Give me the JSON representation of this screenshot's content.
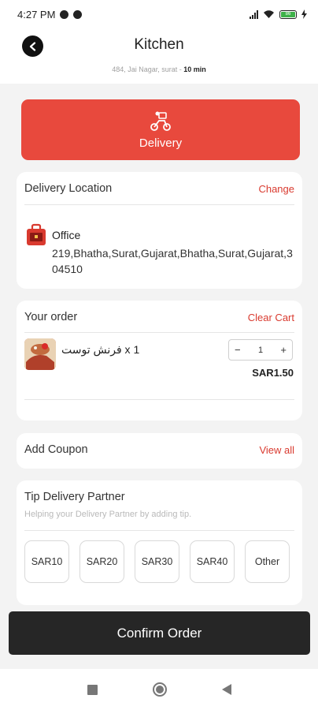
{
  "status_bar": {
    "time": "4:27 PM",
    "battery_level": "86"
  },
  "header": {
    "title": "Kitchen",
    "address": "484, Jai Nagar, surat",
    "separator": " - ",
    "eta": "10 min"
  },
  "delivery_mode": {
    "label": "Delivery",
    "color": "#e8493d"
  },
  "location": {
    "title": "Delivery Location",
    "change_label": "Change",
    "address_label": "Office",
    "address": "219,Bhatha,Surat,Gujarat,Bhatha,Surat,Gujarat,304510"
  },
  "order": {
    "title": "Your order",
    "clear_label": "Clear Cart",
    "items": [
      {
        "name": "فرنش توست x 1",
        "quantity": "1",
        "price": "SAR1.50",
        "minus": "−",
        "plus": "+"
      }
    ]
  },
  "coupon": {
    "title": "Add Coupon",
    "view_all_label": "View all"
  },
  "tip": {
    "title": "Tip Delivery Partner",
    "subtitle": "Helping your Delivery Partner by adding tip.",
    "options": [
      "SAR10",
      "SAR20",
      "SAR30",
      "SAR40",
      "Other"
    ]
  },
  "confirm": {
    "label": "Confirm Order"
  },
  "colors": {
    "accent": "#d93a2f",
    "dark_button": "#262626"
  }
}
